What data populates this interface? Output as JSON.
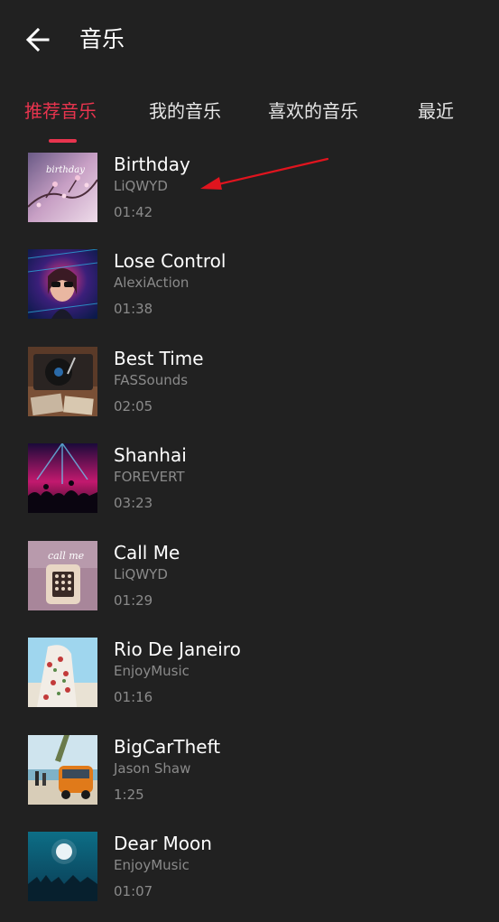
{
  "header": {
    "title": "音乐",
    "back_icon": "arrow-left-icon"
  },
  "tabs": [
    {
      "label": "推荐音乐",
      "active": true
    },
    {
      "label": "我的音乐",
      "active": false
    },
    {
      "label": "喜欢的音乐",
      "active": false
    },
    {
      "label": "最近",
      "active": false
    }
  ],
  "colors": {
    "background": "#212121",
    "accent": "#e8344e",
    "secondary_text": "#8a8a8a",
    "annotation_arrow": "#e0141e"
  },
  "songs": [
    {
      "title": "Birthday",
      "artist": "LiQWYD",
      "duration": "01:42"
    },
    {
      "title": "Lose Control",
      "artist": "AlexiAction",
      "duration": "01:38"
    },
    {
      "title": "Best Time",
      "artist": "FASSounds",
      "duration": "02:05"
    },
    {
      "title": "Shanhai",
      "artist": "FOREVERT",
      "duration": "03:23"
    },
    {
      "title": "Call Me",
      "artist": "LiQWYD",
      "duration": "01:29"
    },
    {
      "title": "Rio De Janeiro",
      "artist": "EnjoyMusic",
      "duration": "01:16"
    },
    {
      "title": "BigCarTheft",
      "artist": "Jason Shaw",
      "duration": "1:25"
    },
    {
      "title": "Dear Moon",
      "artist": "EnjoyMusic",
      "duration": "01:07"
    }
  ],
  "covers": {
    "birthday_text": "birthday",
    "callme_text": "call me"
  }
}
